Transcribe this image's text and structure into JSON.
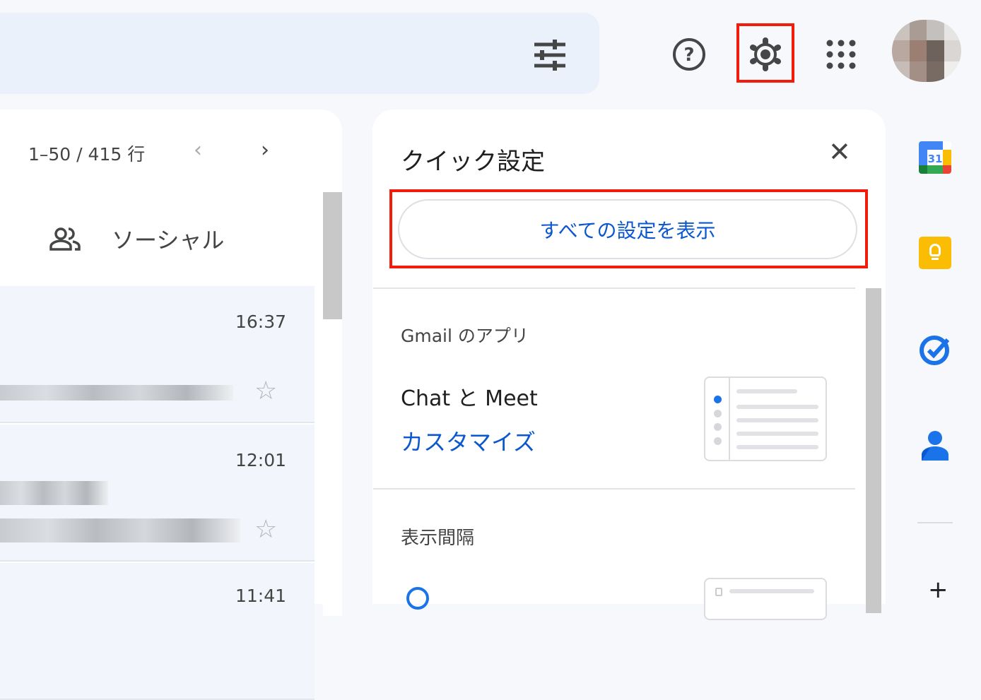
{
  "header": {
    "filter_icon": "tune-icon",
    "help_icon": "help-icon",
    "settings_icon": "gear-icon",
    "apps_icon": "apps-grid-icon"
  },
  "mail": {
    "pagination": "1–50 / 415 行",
    "tab_social": "ソーシャル",
    "rows": [
      {
        "time": "16:37"
      },
      {
        "time": "12:01"
      },
      {
        "time": "11:41"
      }
    ]
  },
  "quick_settings": {
    "title": "クイック設定",
    "all_settings_button": "すべての設定を表示",
    "apps_section": "Gmail のアプリ",
    "chat_meet": "Chat と Meet",
    "customize": "カスタマイズ",
    "density_section": "表示間隔"
  },
  "side_apps": [
    "calendar",
    "keep",
    "tasks",
    "contacts"
  ],
  "colors": {
    "accent": "#0b57d0",
    "highlight": "#f21c0c",
    "background": "#f6f8fc"
  },
  "calendar_day": "31"
}
